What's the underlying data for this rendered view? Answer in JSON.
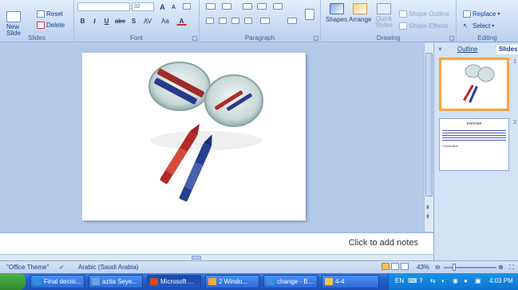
{
  "ribbon": {
    "slides": {
      "new_slide": "New\nSlide",
      "reset": "Reset",
      "delete": "Delete",
      "label": "Slides"
    },
    "font": {
      "size_value": "32",
      "bold": "B",
      "italic": "I",
      "underline": "U",
      "strike": "abe",
      "shadow": "S",
      "spacing": "AV",
      "case": "Aa",
      "color": "A",
      "grow": "A",
      "shrink": "A",
      "label": "Font"
    },
    "paragraph": {
      "label": "Paragraph"
    },
    "drawing": {
      "shapes": "Shapes",
      "arrange": "Arrange",
      "quick_styles": "Quick\nStyles",
      "shape_outline": "Shape Outline",
      "shape_effects": "Shape Effects",
      "label": "Drawing"
    },
    "editing": {
      "replace": "Replace",
      "select": "Select",
      "label": "Editing"
    }
  },
  "pane": {
    "tabs": [
      "Outline",
      "Slides"
    ],
    "thumb2": {
      "title": "exercise",
      "bullet2": "Conclusion"
    },
    "thumb_numbers": [
      "1",
      "2"
    ]
  },
  "notes": {
    "placeholder": "Click to add notes"
  },
  "status": {
    "theme": "\"Office Theme\"",
    "language": "Arabic (Saudi Arabia)",
    "zoom": "43%"
  },
  "taskbar": {
    "items": [
      {
        "label": "Final decisi...",
        "color": "#2f8de4"
      },
      {
        "label": "azita Seye...",
        "color": "#6aa3e0"
      },
      {
        "label": "Microsoft ...",
        "color": "#d24726"
      },
      {
        "label": "2 Windo...",
        "color": "#f4a83a"
      },
      {
        "label": "change - B...",
        "color": "#3a8fe0"
      },
      {
        "label": "4-4",
        "color": "#f3c64a"
      }
    ],
    "lang": "EN",
    "clock": "4:03 PM"
  }
}
